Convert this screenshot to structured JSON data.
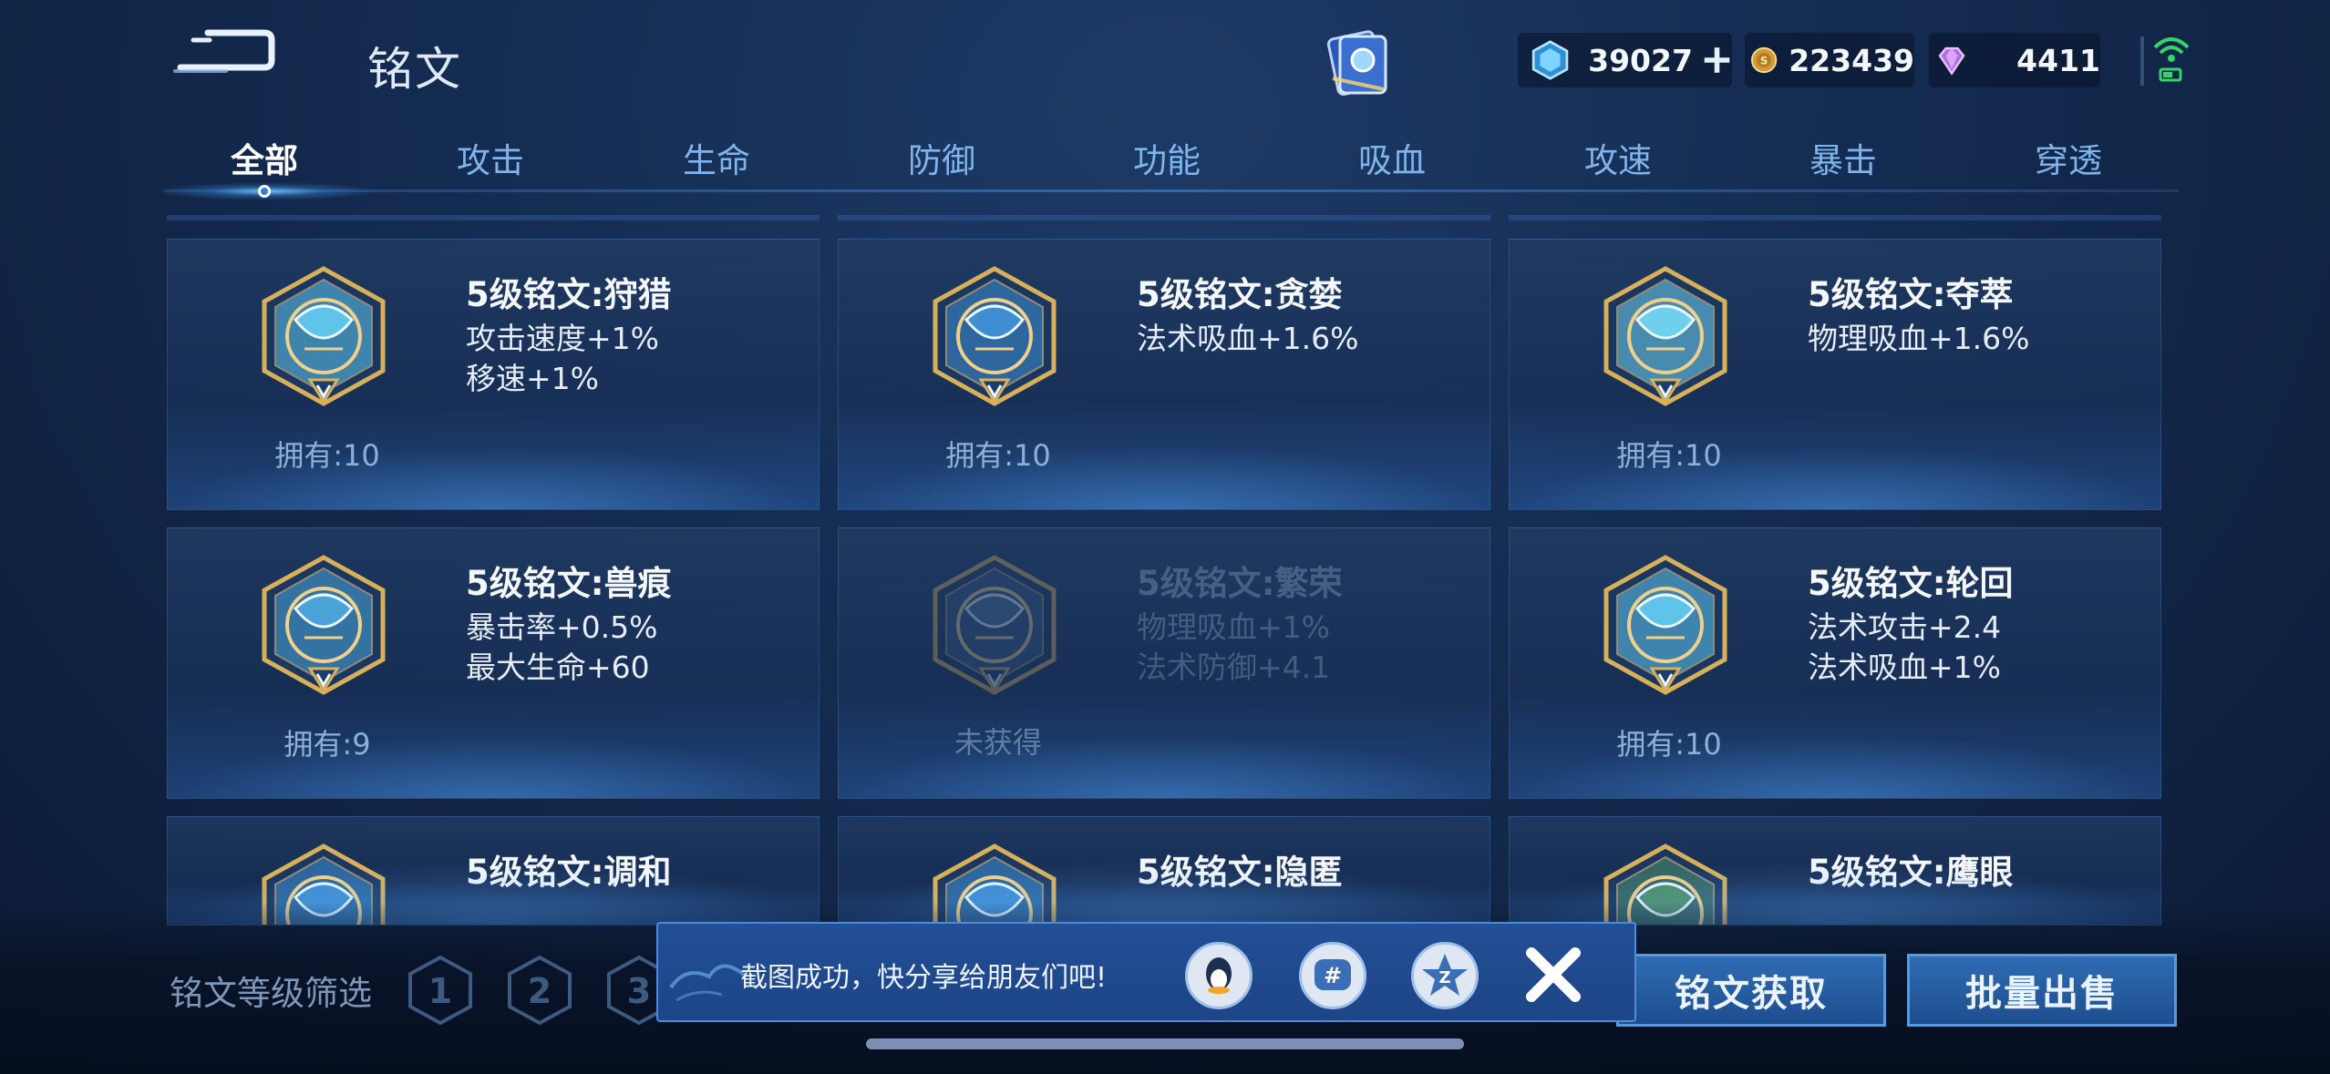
{
  "header": {
    "title": "铭文",
    "currencies": {
      "voucher": "39027",
      "gold": "223439",
      "diamond": "4411"
    }
  },
  "tabs": [
    {
      "label": "全部"
    },
    {
      "label": "攻击"
    },
    {
      "label": "生命"
    },
    {
      "label": "防御"
    },
    {
      "label": "功能"
    },
    {
      "label": "吸血"
    },
    {
      "label": "攻速"
    },
    {
      "label": "暴击"
    },
    {
      "label": "穿透"
    }
  ],
  "active_tab": "全部",
  "runes": [
    {
      "name": "5级铭文:狩猎",
      "attrs": [
        "攻击速度+1%",
        "移速+1%"
      ],
      "owned": "拥有:10",
      "color": "#5ec4ea"
    },
    {
      "name": "5级铭文:贪婪",
      "attrs": [
        "法术吸血+1.6%"
      ],
      "owned": "拥有:10",
      "color": "#3f8ed2"
    },
    {
      "name": "5级铭文:夺萃",
      "attrs": [
        "物理吸血+1.6%"
      ],
      "owned": "拥有:10",
      "color": "#6fd0ee"
    },
    {
      "name": "5级铭文:兽痕",
      "attrs": [
        "暴击率+0.5%",
        "最大生命+60"
      ],
      "owned": "拥有:9",
      "color": "#4aa3d8"
    },
    {
      "name": "5级铭文:繁荣",
      "attrs": [
        "物理吸血+1%",
        "法术防御+4.1"
      ],
      "owned": "未获得",
      "color": "#4a6f98"
    },
    {
      "name": "5级铭文:轮回",
      "attrs": [
        "法术攻击+2.4",
        "法术吸血+1%"
      ],
      "owned": "拥有:10",
      "color": "#5ec4ea"
    },
    {
      "name": "5级铭文:调和",
      "attrs": [],
      "owned": "",
      "color": "#3f8ed2"
    },
    {
      "name": "5级铭文:隐匿",
      "attrs": [],
      "owned": "",
      "color": "#3f8ed2"
    },
    {
      "name": "5级铭文:鹰眼",
      "attrs": [],
      "owned": "",
      "color": "#4f8f6a"
    }
  ],
  "footer": {
    "filter_label": "铭文等级筛选",
    "levels": [
      "1",
      "2",
      "3"
    ],
    "btn_get": "铭文获取",
    "btn_sell": "批量出售"
  },
  "toast": {
    "text": "截图成功，快分享给朋友们吧!"
  },
  "colors": {
    "accent": "#2f6cb3",
    "gold": "#d8b05a",
    "tab_inactive": "#80b4ec"
  }
}
